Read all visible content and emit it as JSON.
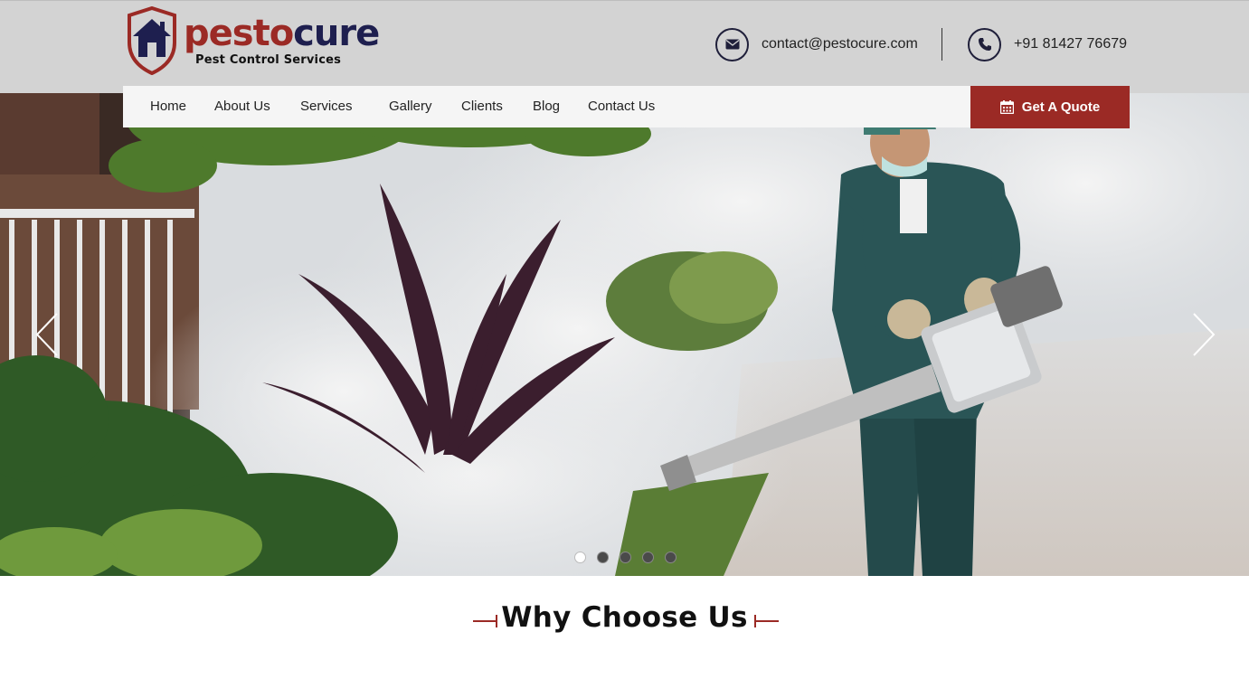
{
  "brand": {
    "name_part1": "pesto",
    "name_part2": "cure",
    "tagline": "Pest Control Services"
  },
  "contact": {
    "email": "contact@pestocure.com",
    "phone": "+91 81427 76679",
    "email_icon": "envelope-icon",
    "phone_icon": "phone-icon"
  },
  "nav": {
    "items": [
      {
        "label": "Home"
      },
      {
        "label": "About Us"
      },
      {
        "label": "Services"
      },
      {
        "label": "Gallery"
      },
      {
        "label": "Clients"
      },
      {
        "label": "Blog"
      },
      {
        "label": "Contact Us"
      }
    ],
    "quote_label": "Get A Quote",
    "quote_icon": "calendar-icon"
  },
  "slider": {
    "slide_count": 5,
    "active_slide": 1
  },
  "section": {
    "title": "Why Choose Us"
  },
  "colors": {
    "brand_red": "#9b2a25",
    "brand_navy": "#1e1f4f",
    "header_bg": "#d3d3d3",
    "nav_bg": "#f5f5f5"
  }
}
